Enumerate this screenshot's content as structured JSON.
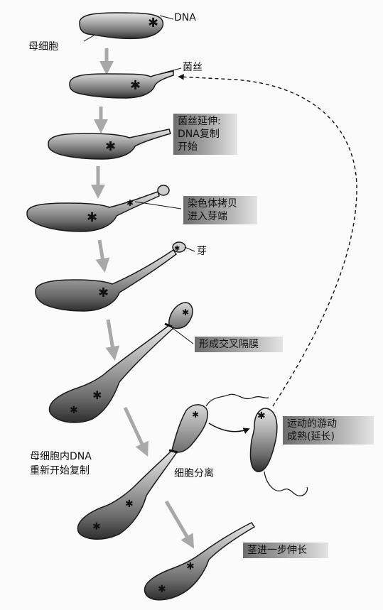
{
  "labels": {
    "dna": "DNA",
    "mother_cell": "母细胞",
    "hypha": "菌丝",
    "bud": "芽",
    "cell_separation": "细胞分离",
    "mother_dna_line1": "母细胞内DNA",
    "mother_dna_line2": "重新开始复制"
  },
  "boxes": {
    "hypha_extension": [
      "菌丝延伸:",
      "DNA复制",
      "开始"
    ],
    "chromosome_copy": [
      "染色体拷贝",
      "进入芽端"
    ],
    "septum": [
      "形成交叉隔膜"
    ],
    "swarmer": [
      "运动的游动",
      "成熟(延长)"
    ],
    "stalk": [
      "茎进一步伸长"
    ]
  },
  "colors": {
    "cell_body": "#9a9a9a",
    "cell_dark": "#3a3a3a",
    "arrow": "#a8a8a8",
    "ink": "#111111"
  }
}
